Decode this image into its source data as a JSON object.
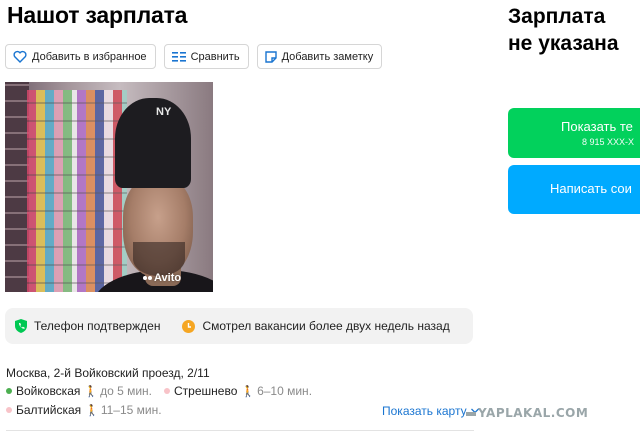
{
  "listing": {
    "title": "Нашот зарплата",
    "salary_line1": "Зарплата",
    "salary_line2": "не указана"
  },
  "actions": {
    "favorite_label": "Добавить в избранное",
    "compare_label": "Сравнить",
    "note_label": "Добавить заметку",
    "icons": [
      "heart-icon",
      "compare-icon",
      "note-icon"
    ]
  },
  "photo": {
    "hat_logo": "NY",
    "watermark": "Avito"
  },
  "badges": {
    "phone_verified": "Телефон подтвержден",
    "viewed_vacancies": "Смотрел вакансии более двух недель назад",
    "phone_color": "#00c853",
    "viewed_color": "#f5a623"
  },
  "location": {
    "address": "Москва, 2-й Войковский проезд, 2/11",
    "metro": [
      {
        "name": "Войковская",
        "time": "до 5 мин.",
        "color": "#4caf50"
      },
      {
        "name": "Стрешнево",
        "time": "6–10 мин.",
        "color": "#f8c3c8"
      },
      {
        "name": "Балтийская",
        "time": "11–15 мин.",
        "color": "#f8c3c8"
      }
    ],
    "show_map": "Показать карту"
  },
  "contact": {
    "call_label": "Показать те",
    "call_phone": "8 915 XXX-X",
    "message_label": "Написать сои",
    "call_color": "#02d15c",
    "message_color": "#00aaff"
  },
  "watermark_site": "YAPLAKAL.COM"
}
